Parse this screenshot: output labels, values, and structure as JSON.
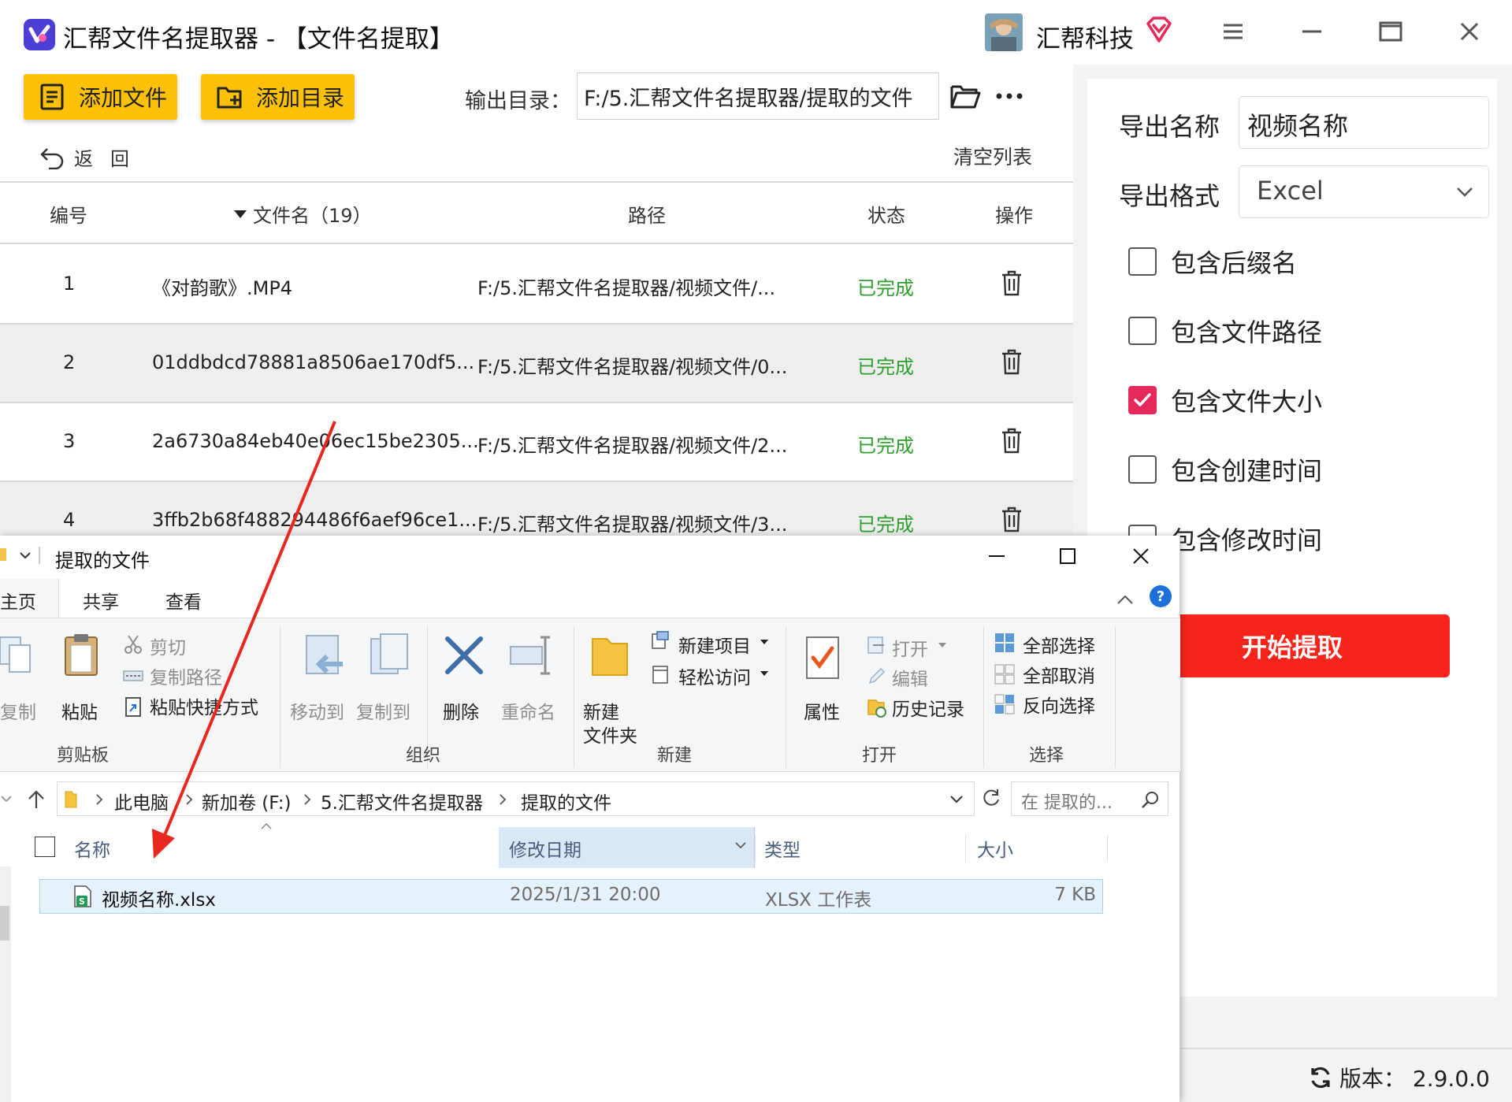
{
  "app": {
    "title": "汇帮文件名提取器 - 【文件名提取】",
    "company": "汇帮科技",
    "toolbar": {
      "add_file": "添加文件",
      "add_dir": "添加目录",
      "output_label": "输出目录：",
      "output_value": "F:/5.汇帮文件名提取器/提取的文件"
    },
    "back": "返回",
    "clear": "清空列表",
    "table": {
      "headers": {
        "num": "编号",
        "name": "文件名（19）",
        "path": "路径",
        "status": "状态",
        "action": "操作"
      },
      "rows": [
        {
          "num": "1",
          "name": "《对韵歌》.MP4",
          "path": "F:/5.汇帮文件名提取器/视频文件/...",
          "status": "已完成"
        },
        {
          "num": "2",
          "name": "01ddbdcd78881a8506ae170df5...",
          "path": "F:/5.汇帮文件名提取器/视频文件/0...",
          "status": "已完成"
        },
        {
          "num": "3",
          "name": "2a6730a84eb40e06ec15be2305...",
          "path": "F:/5.汇帮文件名提取器/视频文件/2...",
          "status": "已完成"
        },
        {
          "num": "4",
          "name": "3ffb2b68f488294486f6aef96ce1...",
          "path": "F:/5.汇帮文件名提取器/视频文件/3...",
          "status": "已完成"
        }
      ]
    },
    "right": {
      "export_name_label": "导出名称",
      "export_name_value": "视频名称",
      "export_format_label": "导出格式",
      "export_format_value": "Excel",
      "options": [
        {
          "label": "包含后缀名",
          "checked": false
        },
        {
          "label": "包含文件路径",
          "checked": false
        },
        {
          "label": "包含文件大小",
          "checked": true
        },
        {
          "label": "包含创建时间",
          "checked": false
        },
        {
          "label": "包含修改时间",
          "checked": false
        }
      ],
      "start": "开始提取"
    },
    "version": "版本：  2.9.0.0",
    "colors": {
      "accent_yellow": "#ffc107",
      "done_green": "#2e9e2e",
      "start_red": "#f5251b",
      "check_pink": "#e5295b"
    }
  },
  "explorer": {
    "title": "提取的文件",
    "tabs": [
      "主页",
      "共享",
      "查看"
    ],
    "ribbon": {
      "copy": "复制",
      "paste": "粘贴",
      "cut": "剪切",
      "copy_path": "复制路径",
      "paste_shortcut": "粘贴快捷方式",
      "clipboard": "剪贴板",
      "move_to": "移动到",
      "copy_to": "复制到",
      "delete": "删除",
      "rename": "重命名",
      "organize": "组织",
      "new_folder_1": "新建",
      "new_folder_2": "文件夹",
      "new_item": "新建项目",
      "easy_access": "轻松访问",
      "new_group": "新建",
      "properties": "属性",
      "open": "打开",
      "edit": "编辑",
      "history": "历史记录",
      "open_group": "打开",
      "select_all": "全部选择",
      "select_none": "全部取消",
      "invert": "反向选择",
      "select_group": "选择"
    },
    "breadcrumbs": [
      "此电脑",
      "新加卷 (F:)",
      "5.汇帮文件名提取器",
      "提取的文件"
    ],
    "search_placeholder": "在 提取的...",
    "columns": {
      "name": "名称",
      "modified": "修改日期",
      "type": "类型",
      "size": "大小"
    },
    "file": {
      "name": "视频名称.xlsx",
      "modified": "2025/1/31 20:00",
      "type": "XLSX 工作表",
      "size": "7 KB"
    }
  }
}
